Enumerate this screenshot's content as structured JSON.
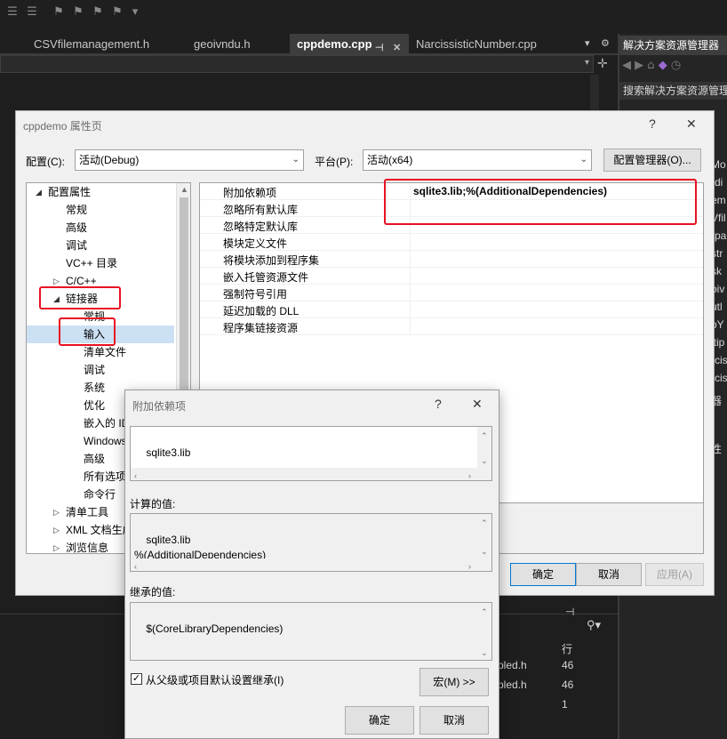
{
  "ide": {
    "tabs": [
      {
        "label": "CSVfilemanagement.h"
      },
      {
        "label": "geoivndu.h"
      },
      {
        "label": "cppdemo.cpp"
      },
      {
        "label": "NarcissisticNumber.cpp"
      }
    ],
    "solution_explorer": {
      "title": "解决方案资源管理器",
      "search_placeholder": "搜索解决方案资源管理",
      "fragments": [
        "解决方案",
        "p",
        "解",
        "Mo",
        "rdi",
        "em",
        "Vfil",
        "rpa",
        "str",
        "sk",
        "oiv",
        "utl",
        "pY",
        "ltip",
        "rcis",
        "rcis",
        "器",
        "性"
      ]
    },
    "error_list": {
      "col_line": "行",
      "rows": [
        {
          "file": "pled.h",
          "line": "46"
        },
        {
          "file": "pled.h",
          "line": "46"
        },
        {
          "file": "",
          "line": "1"
        }
      ]
    }
  },
  "prop_dialog": {
    "title": "cppdemo 属性页",
    "help_glyph": "?",
    "close_glyph": "✕",
    "config_label": "配置(C):",
    "config_value": "活动(Debug)",
    "platform_label": "平台(P):",
    "platform_value": "活动(x64)",
    "config_manager_btn": "配置管理器(O)...",
    "tree": [
      {
        "label": "配置属性",
        "level": 0,
        "expander": "◢"
      },
      {
        "label": "常规",
        "level": 1
      },
      {
        "label": "高级",
        "level": 1
      },
      {
        "label": "调试",
        "level": 1
      },
      {
        "label": "VC++ 目录",
        "level": 1
      },
      {
        "label": "C/C++",
        "level": 1,
        "expander": "▷"
      },
      {
        "label": "链接器",
        "level": 1,
        "expander": "◢"
      },
      {
        "label": "常规",
        "level": 2
      },
      {
        "label": "输入",
        "level": 2,
        "selected": true
      },
      {
        "label": "清单文件",
        "level": 2
      },
      {
        "label": "调试",
        "level": 2
      },
      {
        "label": "系统",
        "level": 2
      },
      {
        "label": "优化",
        "level": 2
      },
      {
        "label": "嵌入的 IDL",
        "level": 2
      },
      {
        "label": "Windows 元数据",
        "level": 2
      },
      {
        "label": "高级",
        "level": 2
      },
      {
        "label": "所有选项",
        "level": 2
      },
      {
        "label": "命令行",
        "level": 2
      },
      {
        "label": "清单工具",
        "level": 1,
        "expander": "▷"
      },
      {
        "label": "XML 文档生成器",
        "level": 1,
        "expander": "▷"
      },
      {
        "label": "浏览信息",
        "level": 1,
        "expander": "▷"
      }
    ],
    "properties": [
      {
        "name": "附加依赖项",
        "value": "sqlite3.lib;%(AdditionalDependencies)"
      },
      {
        "name": "忽略所有默认库",
        "value": ""
      },
      {
        "name": "忽略特定默认库",
        "value": ""
      },
      {
        "name": "模块定义文件",
        "value": ""
      },
      {
        "name": "将模块添加到程序集",
        "value": ""
      },
      {
        "name": "嵌入托管资源文件",
        "value": ""
      },
      {
        "name": "强制符号引用",
        "value": ""
      },
      {
        "name": "延迟加载的 DLL",
        "value": ""
      },
      {
        "name": "程序集链接资源",
        "value": ""
      }
    ],
    "ok_btn": "确定",
    "cancel_btn": "取消",
    "apply_btn": "应用(A)"
  },
  "dep_dialog": {
    "title": "附加依赖项",
    "help_glyph": "?",
    "close_glyph": "✕",
    "edit_value": "sqlite3.lib",
    "computed_label": "计算的值:",
    "computed_value": "sqlite3.lib\n%(AdditionalDependencies)",
    "inherited_label": "继承的值:",
    "inherited_value": "$(CoreLibraryDependencies)",
    "inherit_checkbox_label": "从父级或项目默认设置继承(I)",
    "inherit_checked": true,
    "macro_btn": "宏(M) >>",
    "ok_btn": "确定",
    "cancel_btn": "取消"
  },
  "colors": {
    "ide_bg": "#1f1f1f",
    "dialog_bg": "#f0f0f0",
    "highlight": "#e81123",
    "selection": "#cce0f4"
  }
}
